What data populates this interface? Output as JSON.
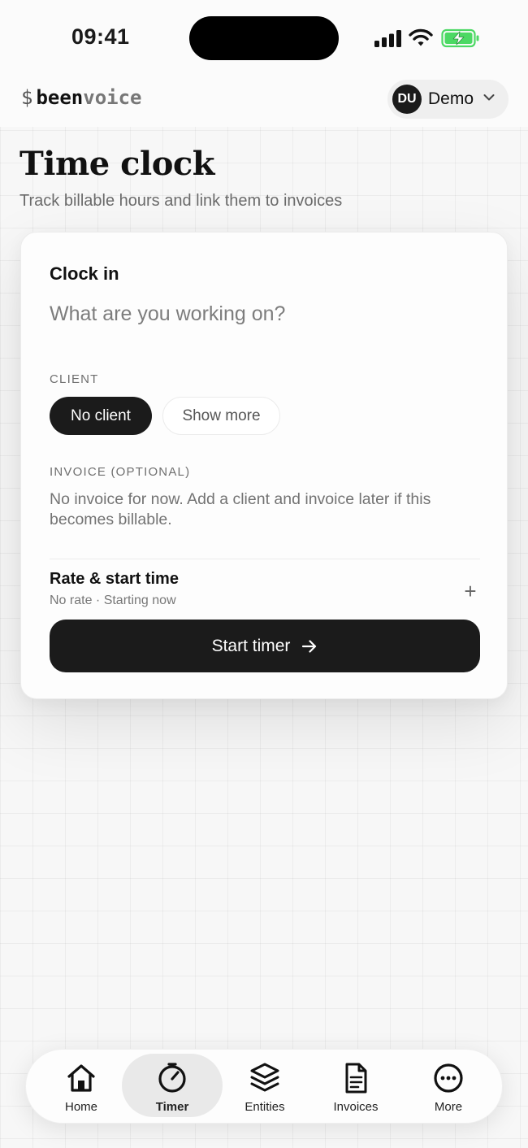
{
  "status_bar": {
    "time": "09:41",
    "icons": [
      "cellular-signal-icon",
      "wifi-icon",
      "battery-charging-icon"
    ]
  },
  "header": {
    "logo": {
      "prefix": "$",
      "strong": "been",
      "light": "voice"
    },
    "account": {
      "initials": "DU",
      "name": "Demo",
      "chevron_icon": "chevron-down-icon"
    }
  },
  "page": {
    "title": "Time clock",
    "subtitle": "Track billable hours and link them to invoices"
  },
  "clock_in": {
    "title": "Clock in",
    "task_placeholder": "What are you working on?",
    "task_value": "",
    "client_label": "CLIENT",
    "client_options": [
      "No client",
      "Show more"
    ],
    "client_selected": "No client",
    "invoice_label": "INVOICE (OPTIONAL)",
    "invoice_note": "No invoice for now. Add a client and invoice later if this becomes billable.",
    "rate_title": "Rate & start time",
    "rate_summary": "No rate · Starting now",
    "expand_symbol": "+",
    "start_button": "Start timer",
    "start_icon": "arrow-right-icon"
  },
  "nav": {
    "active": "Timer",
    "items": [
      {
        "label": "Home",
        "icon": "home-icon"
      },
      {
        "label": "Timer",
        "icon": "timer-icon"
      },
      {
        "label": "Entities",
        "icon": "layers-icon"
      },
      {
        "label": "Invoices",
        "icon": "document-icon"
      },
      {
        "label": "More",
        "icon": "more-icon"
      }
    ]
  },
  "colors": {
    "background": "#f7f7f7",
    "primary_dark": "#1b1b1b",
    "battery_green": "#4cd964",
    "muted_text": "#6b6b6b"
  }
}
